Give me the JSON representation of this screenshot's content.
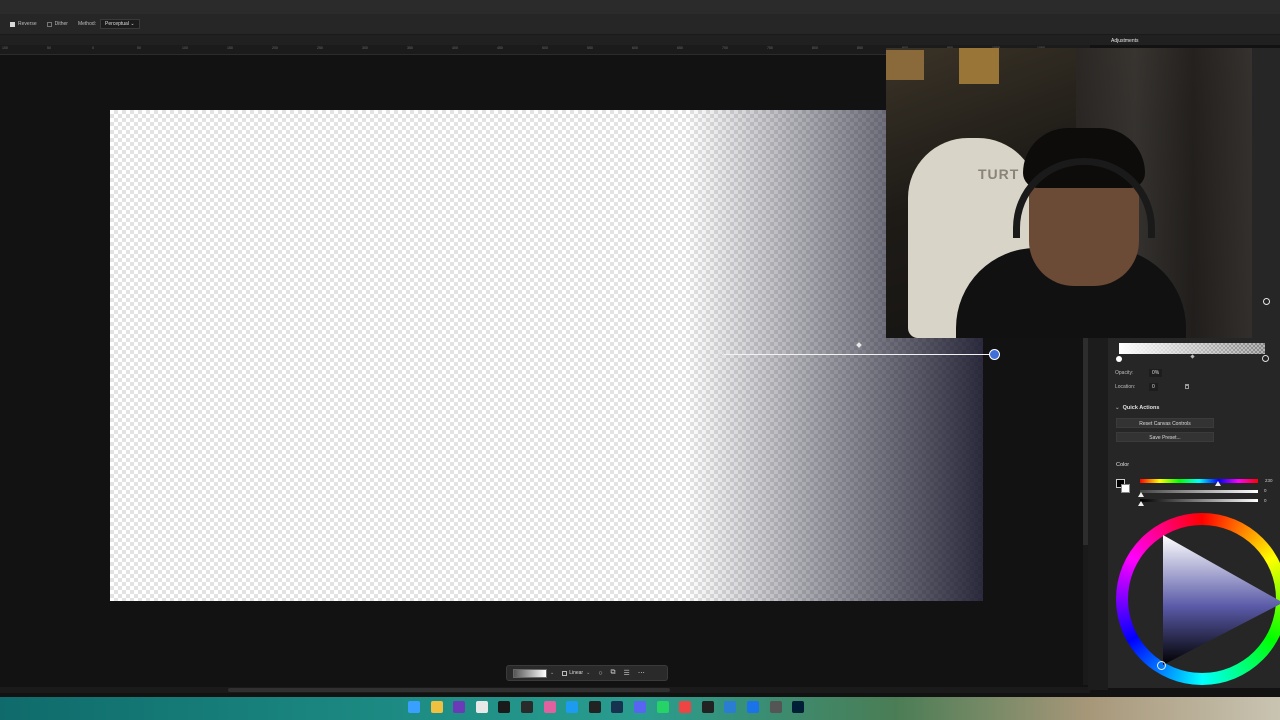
{
  "options_bar": {
    "reverse_label": "Reverse",
    "reverse_checked": true,
    "dither_label": "Dither",
    "dither_checked": false,
    "method_label": "Method:",
    "method_value": "Perceptual"
  },
  "panels_header": {
    "adjustments_tab": "Adjustments"
  },
  "ruler": {
    "ticks": [
      "100",
      "50",
      "0",
      "50",
      "100",
      "150",
      "200",
      "250",
      "300",
      "350",
      "400",
      "450",
      "500",
      "550",
      "600",
      "650",
      "700",
      "750",
      "800",
      "850",
      "900",
      "950",
      "1000",
      "1050"
    ]
  },
  "webcam": {
    "chair_text": "TURT"
  },
  "gradient_panel": {
    "opacity_label": "Opacity:",
    "opacity_value": "0%",
    "location_label": "Location:",
    "location_value": "0"
  },
  "quick_actions": {
    "title": "Quick Actions",
    "reset_button": "Reset Canvas Controls",
    "save_button": "Save Preset..."
  },
  "color_panel": {
    "title": "Color",
    "hue_value": "230",
    "saturation_value": "0",
    "brightness_value": "0"
  },
  "context_bar": {
    "type_label": "Linear"
  },
  "taskbar": {
    "icons": [
      "windows-start-icon",
      "file-explorer-icon",
      "app-purple-icon",
      "notepad-icon",
      "xbox-icon",
      "obs-icon",
      "app-pink-icon",
      "twitter-icon",
      "epic-icon",
      "steam-icon",
      "discord-icon",
      "whatsapp-icon",
      "chrome-icon",
      "media-icon",
      "vscode-icon",
      "mail-icon",
      "app-grid-icon",
      "photoshop-icon"
    ],
    "colors": [
      "#3aa0ff",
      "#f0c040",
      "#6a3ab8",
      "#e8e8e8",
      "#1a1a1a",
      "#2a2a2a",
      "#e060a0",
      "#1d9bf0",
      "#222",
      "#17324f",
      "#5865f2",
      "#25d366",
      "#e44",
      "#222",
      "#2b7cd3",
      "#1a73e8",
      "#555",
      "#001e36"
    ]
  }
}
